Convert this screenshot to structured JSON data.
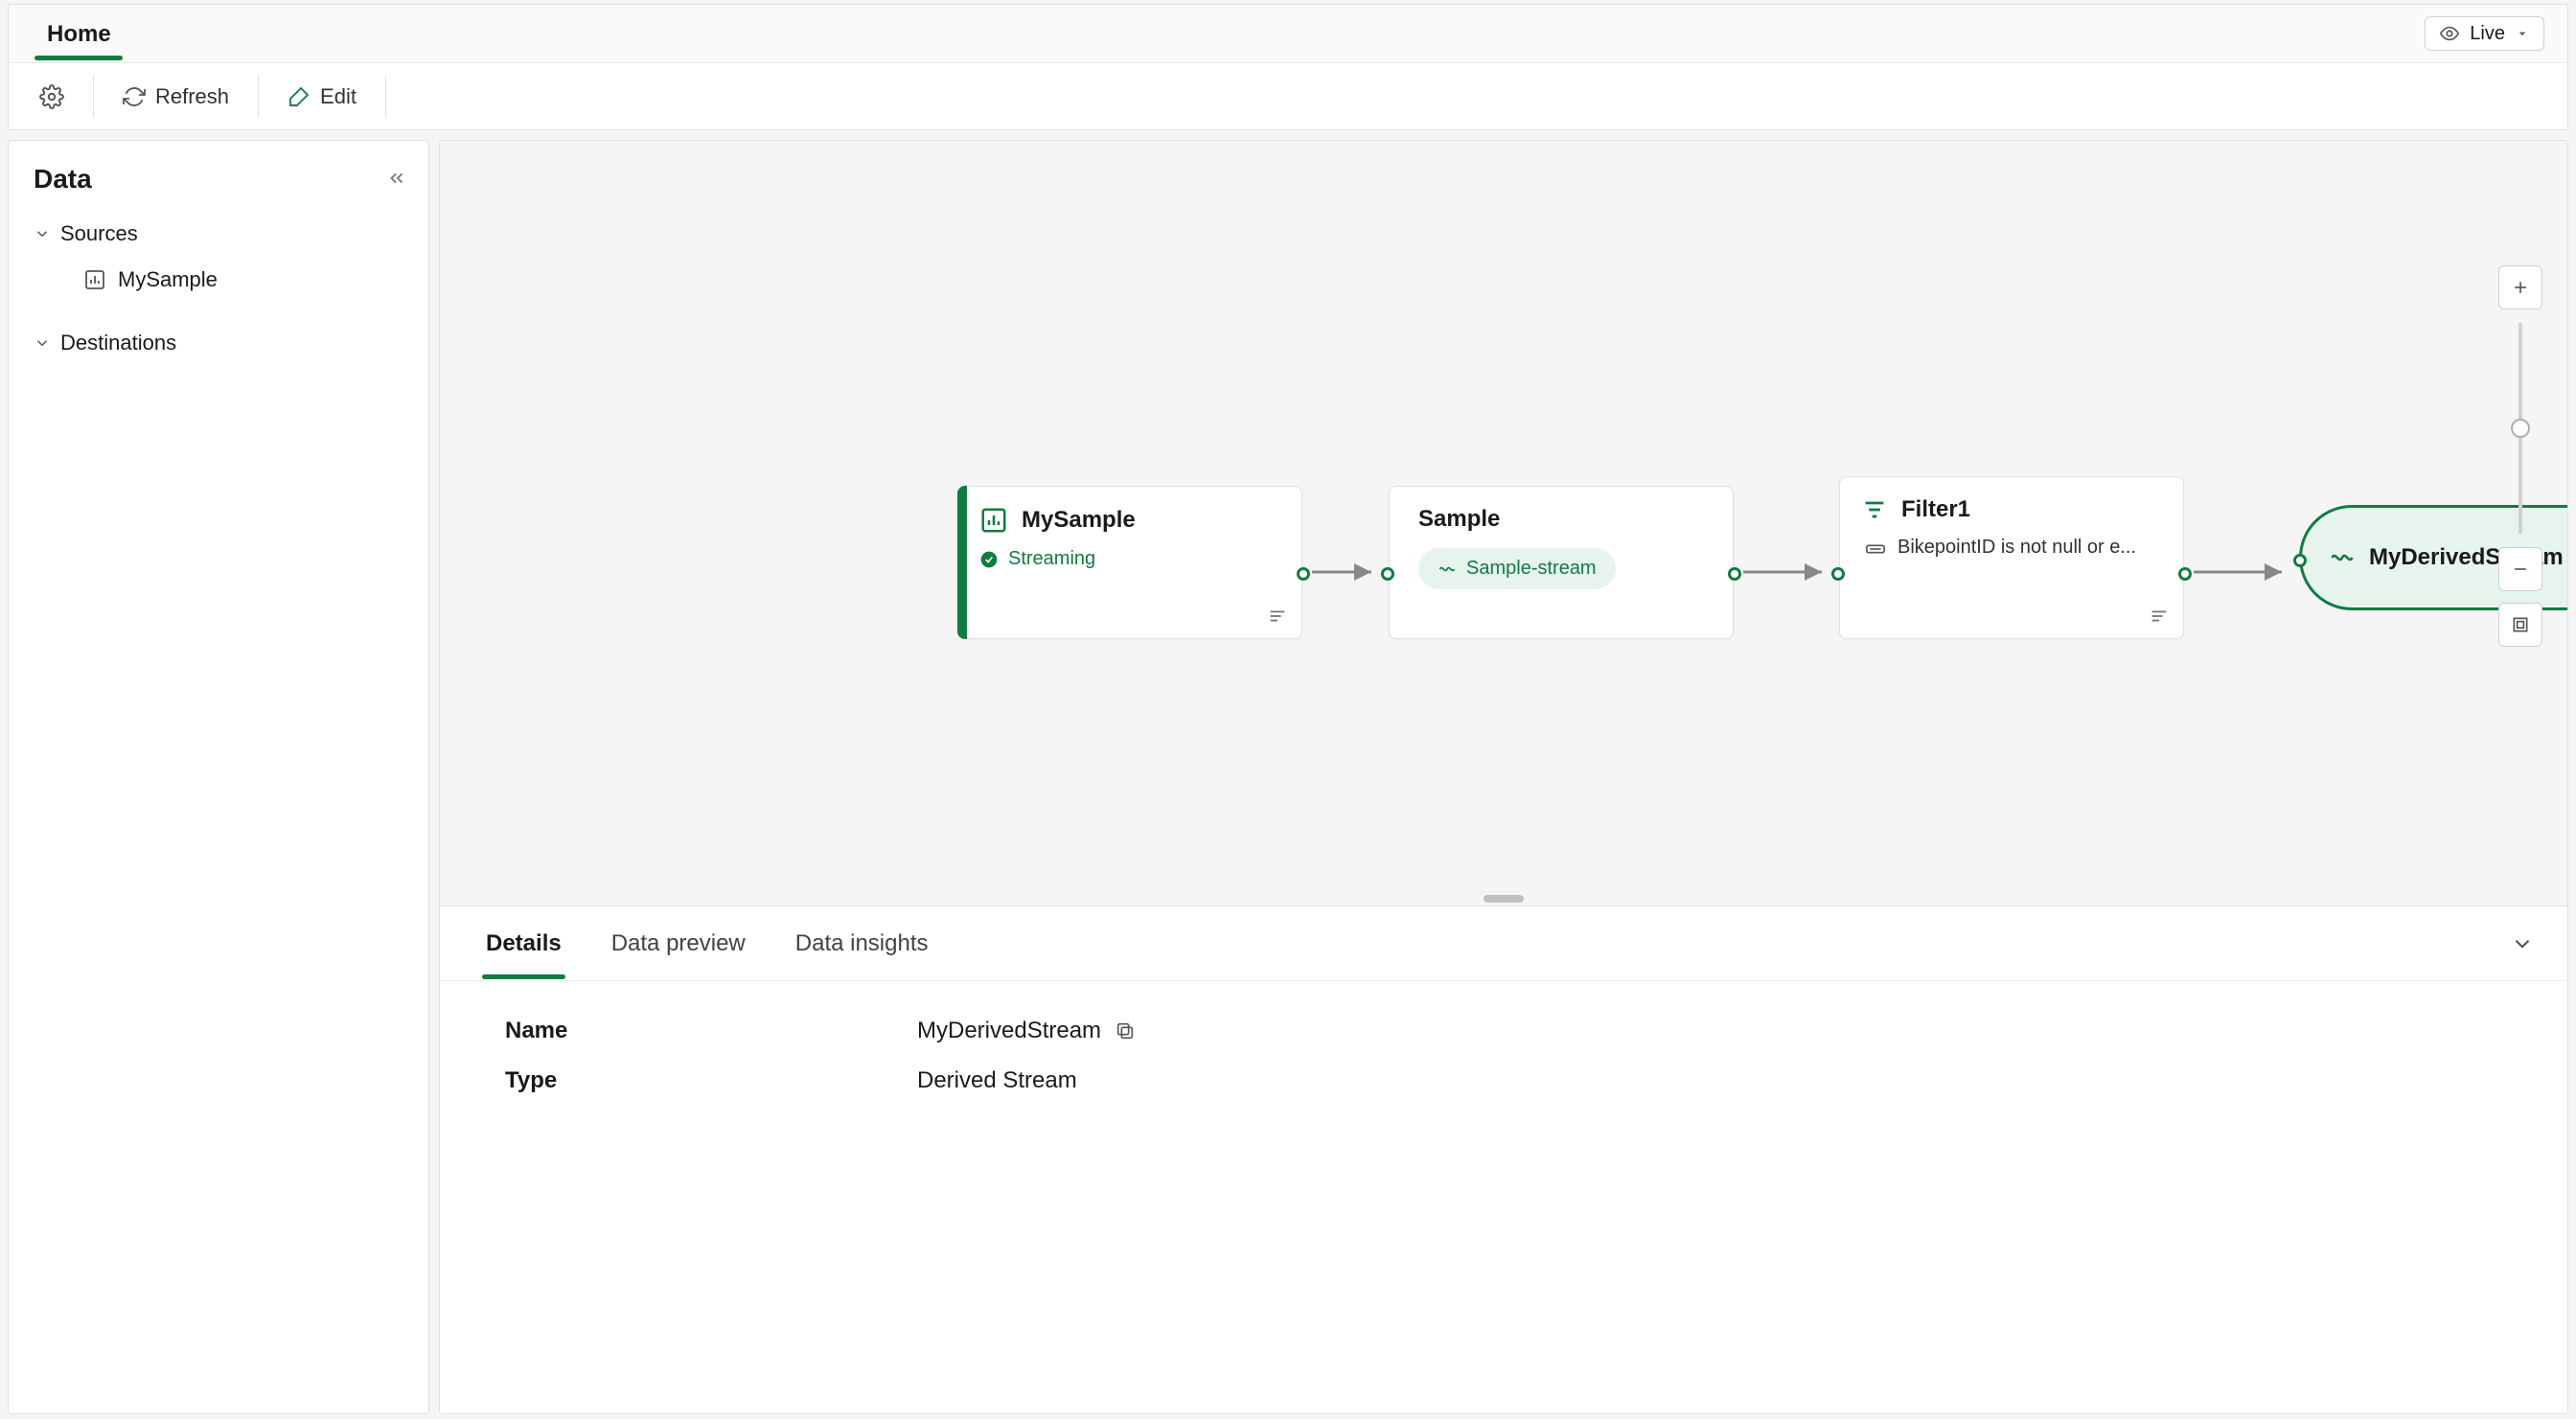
{
  "ribbon": {
    "tabs": [
      "Home"
    ],
    "live_label": "Live",
    "refresh_label": "Refresh",
    "edit_label": "Edit"
  },
  "sidebar": {
    "title": "Data",
    "sources_label": "Sources",
    "sources_item": "MySample",
    "destinations_label": "Destinations"
  },
  "nodes": {
    "source": {
      "title": "MySample",
      "status": "Streaming"
    },
    "sample": {
      "title": "Sample",
      "chip": "Sample-stream"
    },
    "filter": {
      "title": "Filter1",
      "desc": "BikepointID is not null or e..."
    },
    "derived": {
      "title": "MyDerivedStream"
    }
  },
  "bottom": {
    "tabs": [
      "Details",
      "Data preview",
      "Data insights"
    ],
    "name_label": "Name",
    "name_value": "MyDerivedStream",
    "type_label": "Type",
    "type_value": "Derived Stream"
  },
  "icons": {
    "gear": "gear-icon",
    "refresh": "refresh-icon",
    "edit": "edit-icon",
    "eye": "eye-icon",
    "chevdown": "chevron-down-icon",
    "chevleft": "chevron-left-icon",
    "chart": "chart-icon",
    "check": "check-icon",
    "stream": "stream-icon",
    "filter": "filter-icon",
    "menu": "menu-icon",
    "plus": "plus-icon",
    "minus": "minus-icon",
    "fit": "fit-icon",
    "copy": "copy-icon"
  }
}
